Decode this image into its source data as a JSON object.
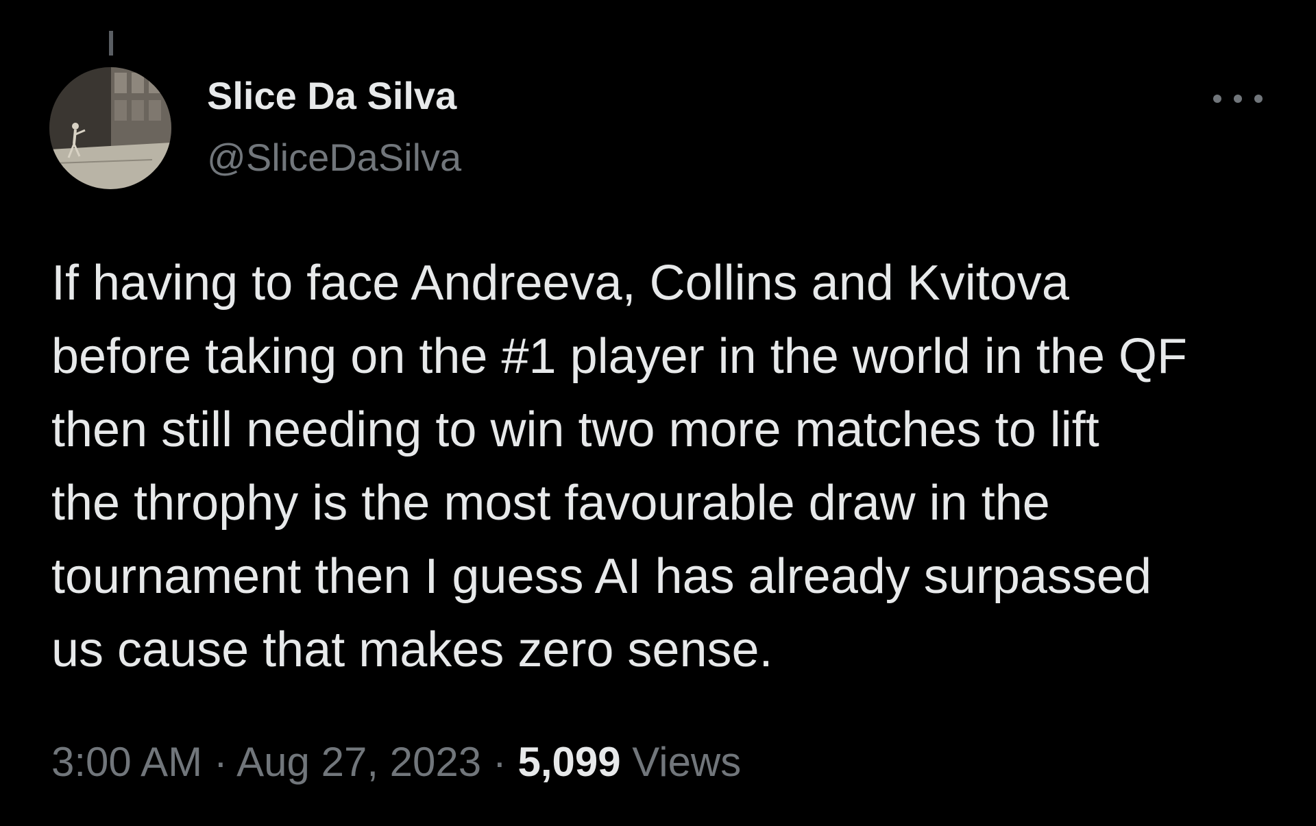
{
  "tweet": {
    "author": {
      "display_name": "Slice Da Silva",
      "handle": "@SliceDaSilva"
    },
    "text_lines": [
      "If having to face Andreeva, Collins and Kvitova",
      "before taking on the #1 player in the world in the QF",
      "then still needing to win two more matches to lift",
      "the throphy is the most favourable draw in the",
      "tournament then I guess AI has already surpassed",
      "us cause that makes zero sense."
    ],
    "meta": {
      "time": "3:00 AM",
      "separator": "·",
      "date": "Aug 27, 2023",
      "views_count": "5,099",
      "views_label": "Views"
    }
  },
  "icons": {
    "more": "more-horizontal-icon"
  },
  "colors": {
    "background": "#000000",
    "primary_text": "#e7e9ea",
    "secondary_text": "#71767b"
  }
}
